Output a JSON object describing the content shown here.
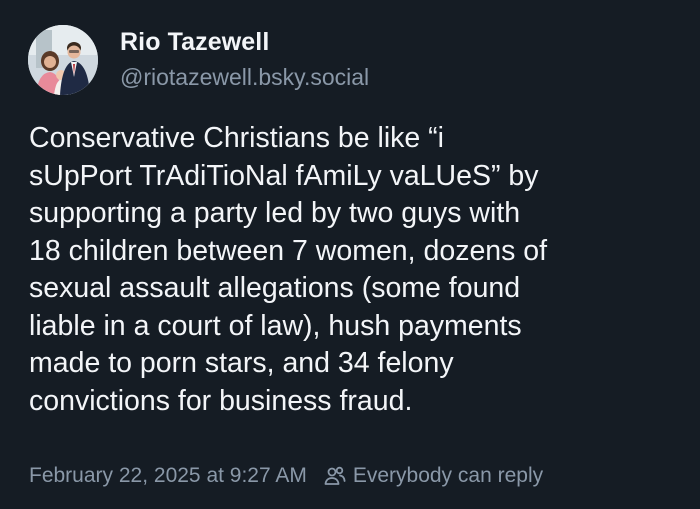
{
  "post": {
    "author": {
      "display_name": "Rio Tazewell",
      "handle": "@riotazewell.bsky.social"
    },
    "text": "Conservative Christians be like “i\nsUpPort TrAdiTioNal fAmiLy vaLUeS” by\nsupporting a party led by two guys with\n18 children between 7 women, dozens of\nsexual assault allegations (some found\nliable in a court of law), hush payments\nmade to porn stars, and 34 felony\nconvictions for business fraud.",
    "timestamp": "February 22, 2025 at 9:27 AM",
    "reply_setting": "Everybody can reply",
    "icons": {
      "reply_setting_icon": "people-icon"
    }
  }
}
